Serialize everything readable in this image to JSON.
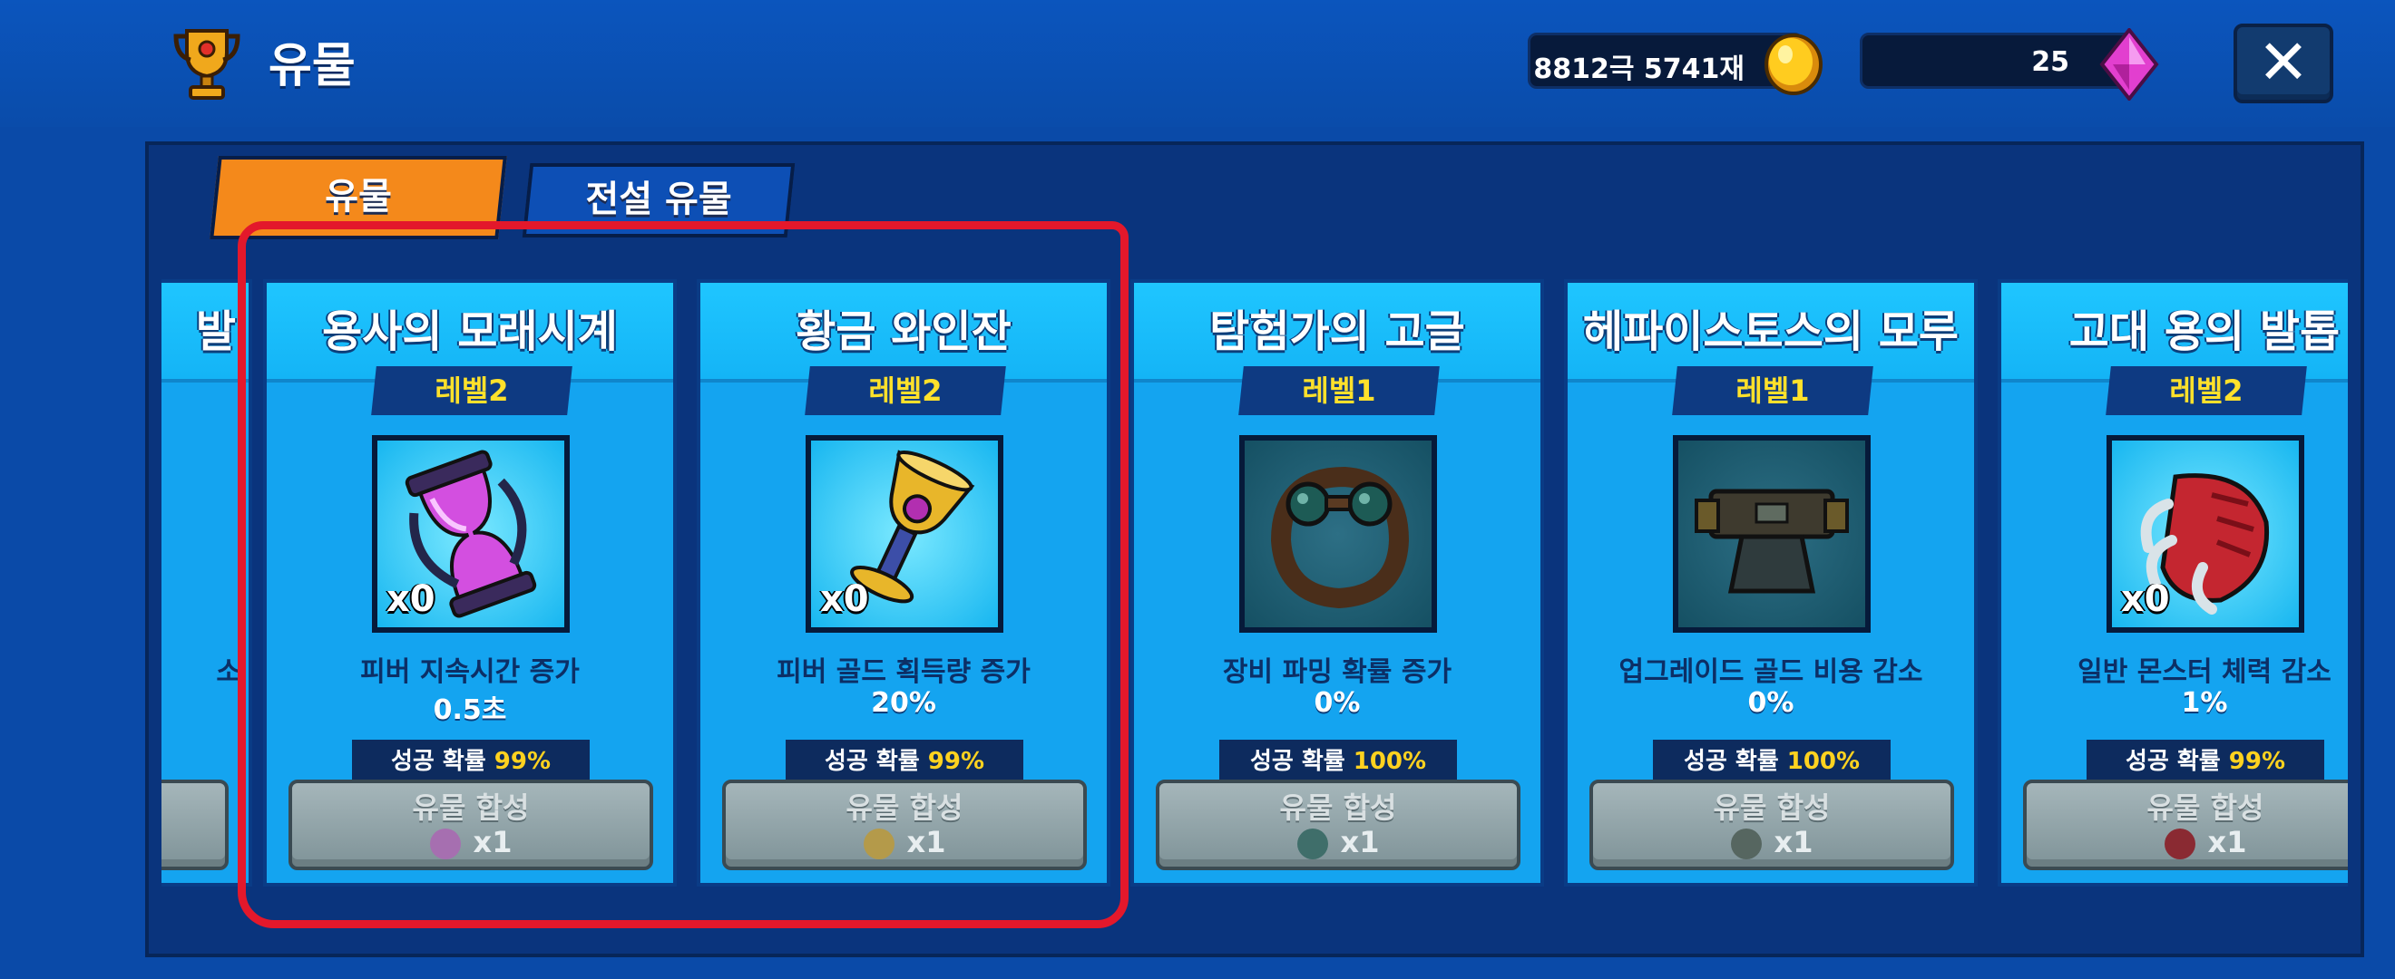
{
  "header": {
    "title": "유물",
    "gold": "8812극 5741재",
    "gems": "25"
  },
  "tabs": [
    {
      "label": "유물",
      "active": true
    },
    {
      "label": "전설 유물",
      "active": false
    }
  ],
  "partial_card": {
    "title": "발",
    "desc": "소"
  },
  "cards": [
    {
      "title": "용사의 모래시계",
      "level": "레벨2",
      "quantity": "x0",
      "desc": "피버 지속시간 증가",
      "value": "0.5초",
      "chance_label": "성공 확률",
      "chance": "99%",
      "combine_label": "유물 합성",
      "cost": "x1",
      "icon": "hourglass-icon",
      "color": "#c23bd4"
    },
    {
      "title": "황금 와인잔",
      "level": "레벨2",
      "quantity": "x0",
      "desc": "피버 골드 획득량 증가",
      "value": "20%",
      "chance_label": "성공 확률",
      "chance": "99%",
      "combine_label": "유물 합성",
      "cost": "x1",
      "icon": "golden-goblet-icon",
      "color": "#e3b42a"
    },
    {
      "title": "탐험가의 고글",
      "level": "레벨1",
      "quantity": "",
      "desc": "장비 파밍 확률 증가",
      "value": "0%",
      "chance_label": "성공 확률",
      "chance": "100%",
      "combine_label": "유물 합성",
      "cost": "x1",
      "icon": "goggles-icon",
      "color": "#2a6b6a"
    },
    {
      "title": "헤파이스토스의 모루",
      "level": "레벨1",
      "quantity": "",
      "desc": "업그레이드 골드 비용 감소",
      "value": "0%",
      "chance_label": "성공 확률",
      "chance": "100%",
      "combine_label": "유물 합성",
      "cost": "x1",
      "icon": "anvil-icon",
      "color": "#3b4a4a"
    },
    {
      "title": "고대 용의 발톱",
      "level": "레벨2",
      "quantity": "x0",
      "desc": "일반 몬스터 체력 감소",
      "value": "1%",
      "chance_label": "성공 확률",
      "chance": "99%",
      "combine_label": "유물 합성",
      "cost": "x1",
      "icon": "dragon-claw-icon",
      "color": "#c42630"
    }
  ],
  "colors": {
    "background": "#0a4aa8",
    "card": "#14a4f0",
    "level_text": "#ffe12b",
    "active_tab": "#f4891b",
    "highlight": "#e3182b"
  }
}
